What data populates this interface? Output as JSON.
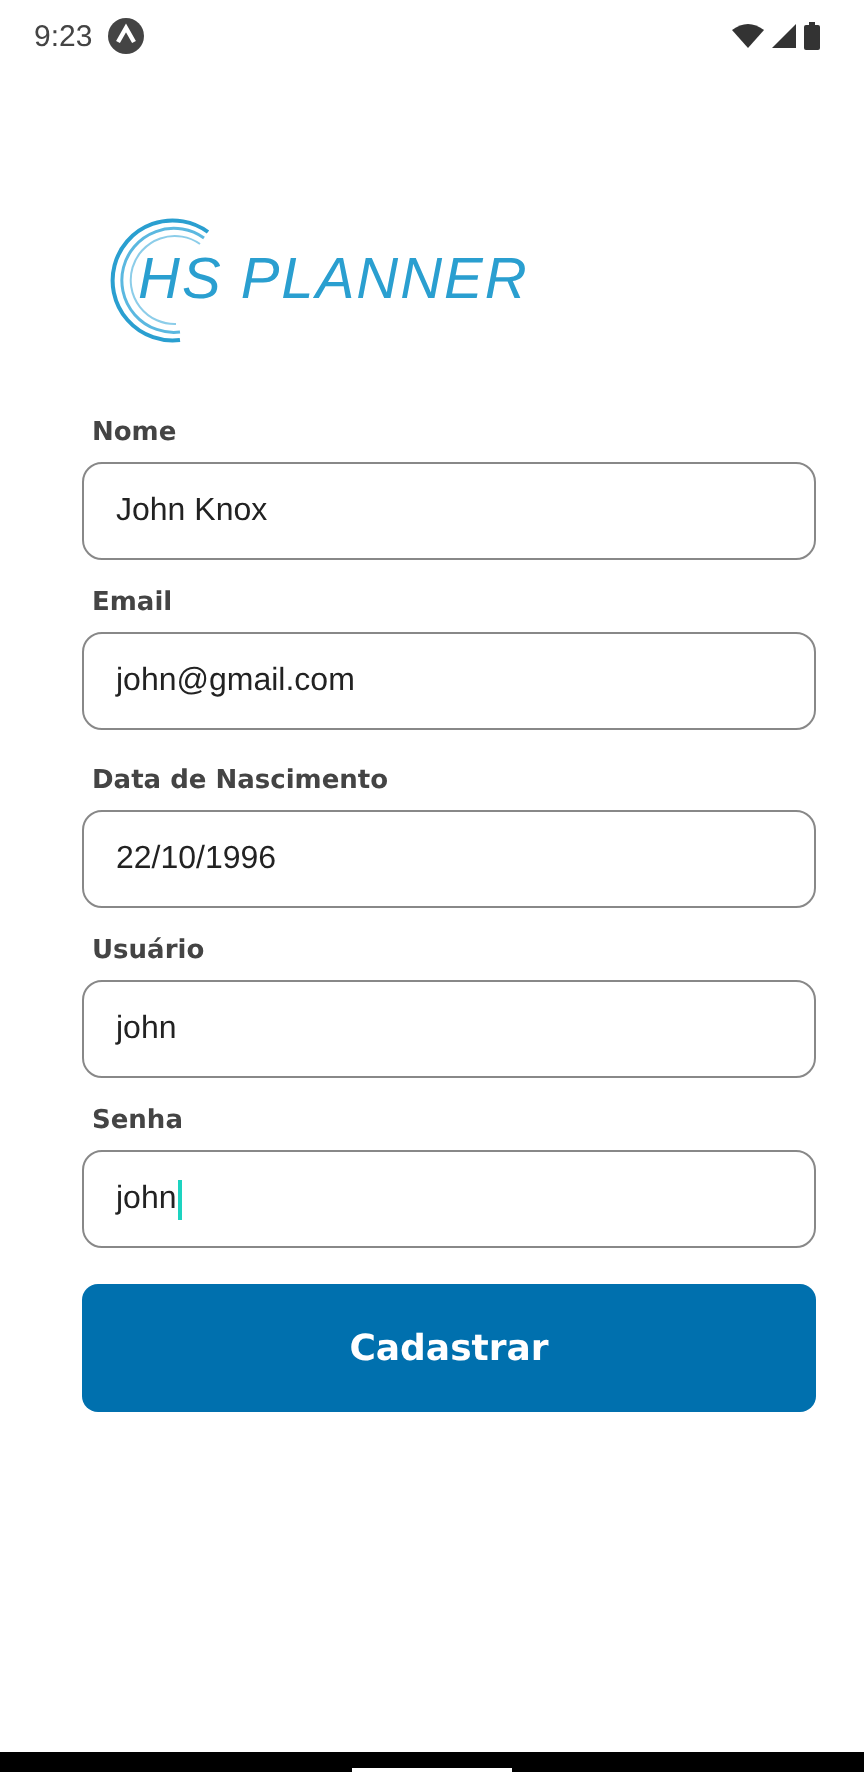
{
  "status_bar": {
    "time": "9:23"
  },
  "logo": {
    "text": "HS PLANNER"
  },
  "fields": [
    {
      "label": "Nome",
      "value": "John Knox",
      "focused": false
    },
    {
      "label": "Email",
      "value": "john@gmail.com",
      "focused": false
    },
    {
      "label": "Data de Nascimento",
      "value": "22/10/1996",
      "focused": false
    },
    {
      "label": "Usuário",
      "value": "john",
      "focused": false
    },
    {
      "label": "Senha",
      "value": "john",
      "focused": true
    }
  ],
  "submit_button": {
    "label": "Cadastrar"
  }
}
